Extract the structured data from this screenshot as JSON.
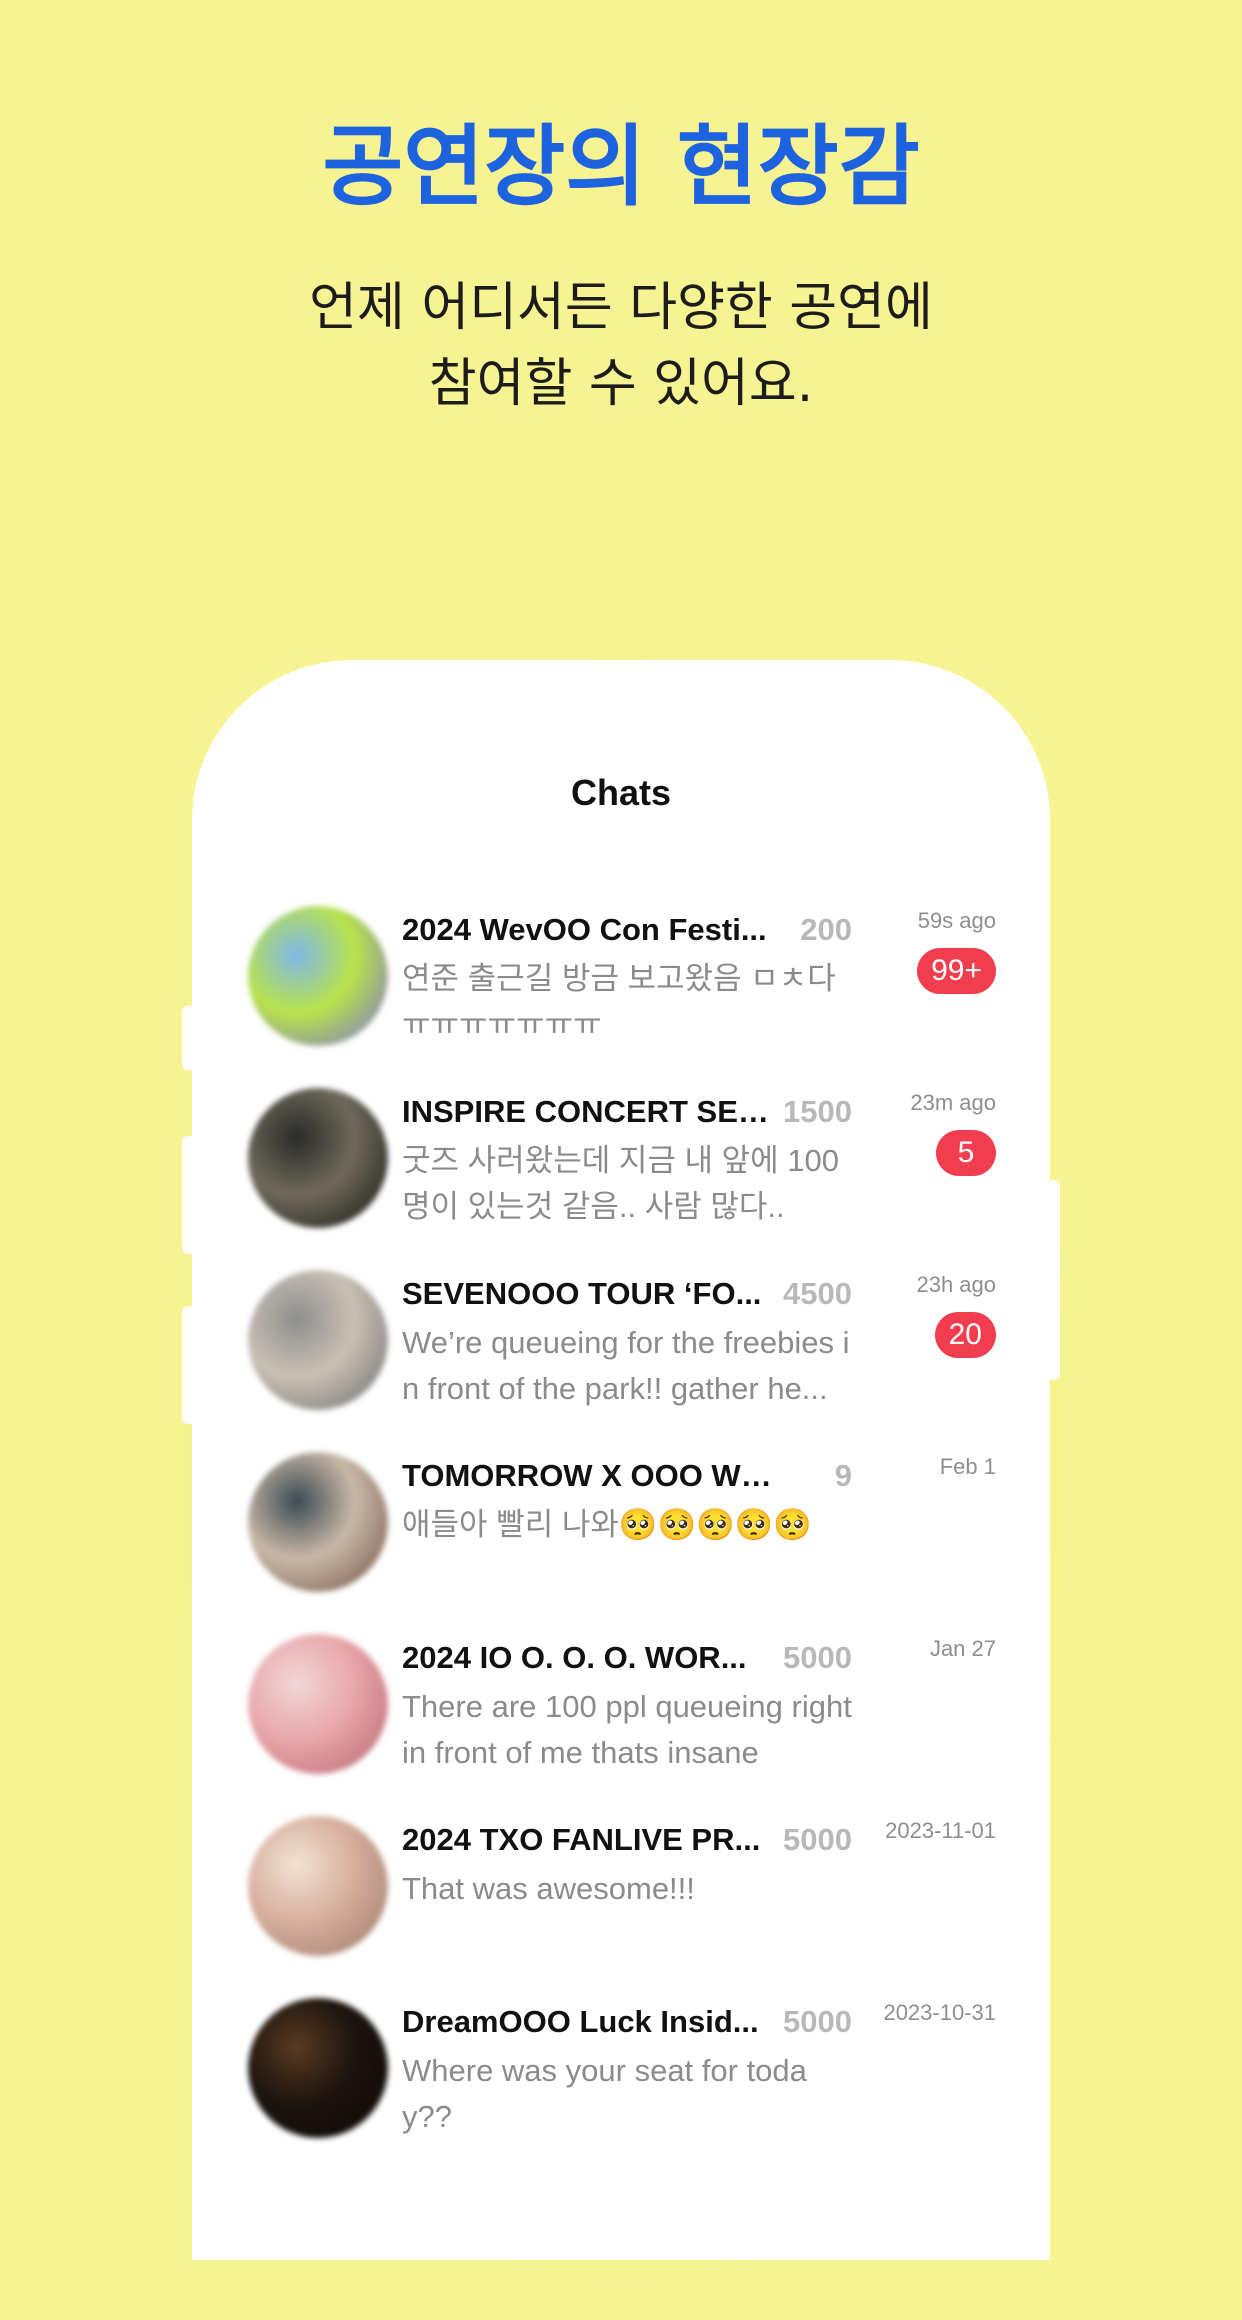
{
  "header": {
    "headline": "공연장의 현장감",
    "subtitle_line1": "언제 어디서든 다양한 공연에",
    "subtitle_line2": "참여할 수 있어요."
  },
  "screen": {
    "title": "Chats"
  },
  "chats": [
    {
      "name": "2024 WevOO Con Festi...",
      "count": "200",
      "preview": "연준 출근길 방금 보고왔음 ㅁㅊ다ㅠㅠㅠㅠㅠㅠㅠ",
      "time": "59s ago",
      "badge": "99+",
      "avatar_colors": [
        "#7fb8e8",
        "#b8e24a",
        "#7a6ad8"
      ]
    },
    {
      "name": "INSPIRE CONCERT SER...",
      "count": "1500",
      "preview": "굿즈 사러왔는데 지금 내 앞에 100명이 있는것 같음.. 사람 많다..",
      "time": "23m ago",
      "badge": "5",
      "avatar_colors": [
        "#2a2a2a",
        "#6f6a5a",
        "#111111"
      ]
    },
    {
      "name": "SEVENOOO TOUR ‘FO...",
      "count": "4500",
      "preview": "We’re queueing for the freebies in front of the park!! gather he...",
      "time": "23h ago",
      "badge": "20",
      "avatar_colors": [
        "#8e8e8e",
        "#c8c0b4",
        "#6a6a6a"
      ]
    },
    {
      "name": "TOMORROW X OOO WORL...",
      "count": "9",
      "preview": "애들아 빨리 나와🥺🥺🥺🥺🥺",
      "time": "Feb 1",
      "badge": "",
      "avatar_colors": [
        "#3b4a54",
        "#c9b8a6",
        "#6e4e40"
      ]
    },
    {
      "name": "2024 IO O. O. O.  WOR...",
      "count": "5000",
      "preview": "There are 100 ppl queueing right in front of me thats insane",
      "time": "Jan 27",
      "badge": "",
      "avatar_colors": [
        "#f1d7d8",
        "#e8a6aa",
        "#b4646c"
      ]
    },
    {
      "name": "2024 TXO FANLIVE PR...",
      "count": "5000",
      "preview": "That was awesome!!!",
      "time": "2023-11-01",
      "badge": "",
      "avatar_colors": [
        "#f2e2d4",
        "#d6ae9c",
        "#9a7a66"
      ]
    },
    {
      "name": "DreamOOO Luck Insid...",
      "count": "5000",
      "preview": "Where was your seat for today??",
      "time": "2023-10-31",
      "badge": "",
      "avatar_colors": [
        "#5a3a20",
        "#1c140e",
        "#0a0806"
      ]
    }
  ],
  "colors": {
    "background": "#f7f392",
    "headline": "#1d63e0",
    "badge": "#f23d4f"
  }
}
